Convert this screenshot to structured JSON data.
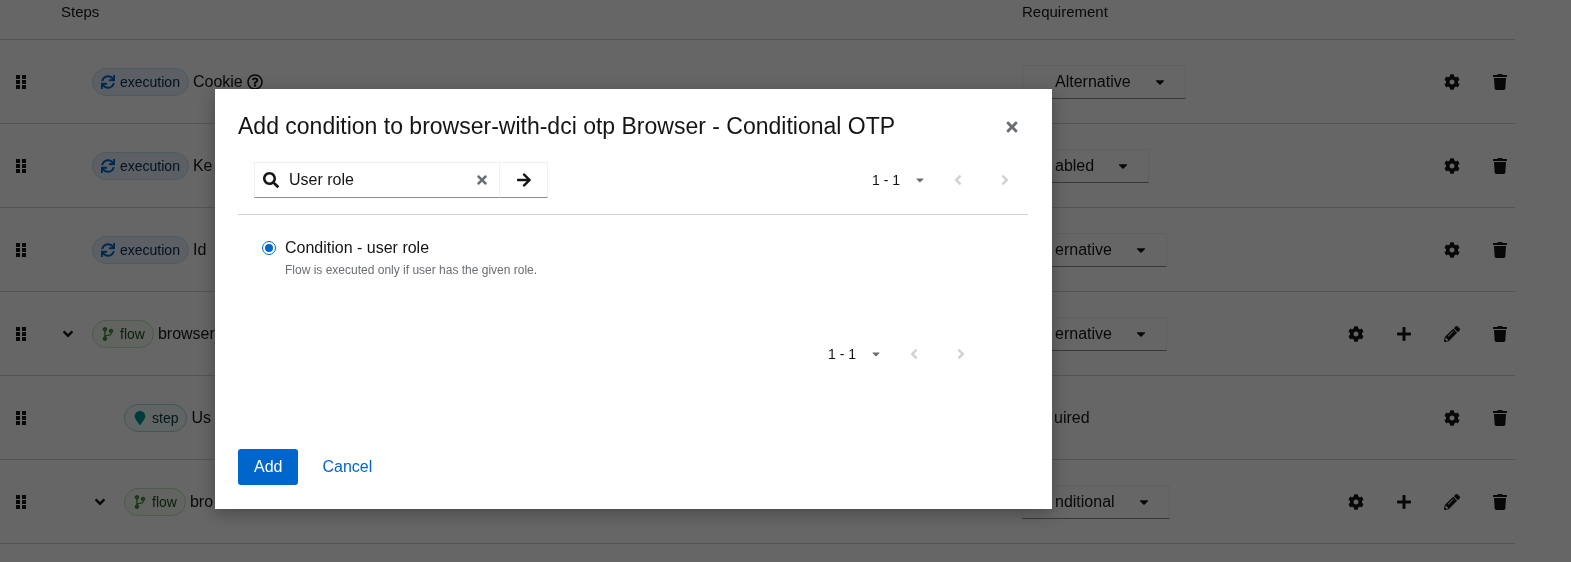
{
  "table": {
    "columns": [
      "Steps",
      "Requirement"
    ],
    "rows": [
      {
        "kind": "execution",
        "badge": "execution",
        "name": "Cookie",
        "help": true,
        "requirement": {
          "kind": "select",
          "value": "Alternative"
        }
      },
      {
        "kind": "execution",
        "badge": "execution",
        "name": "Ke",
        "help": false,
        "requirement": {
          "kind": "select",
          "value": "abled"
        }
      },
      {
        "kind": "execution",
        "badge": "execution",
        "name": "Id",
        "help": false,
        "requirement": {
          "kind": "select",
          "value": "ernative"
        }
      },
      {
        "kind": "flow",
        "badge": "flow",
        "name": "browser",
        "help": false,
        "expanded": true,
        "requirement": {
          "kind": "select",
          "value": "ernative"
        },
        "children": [
          {
            "kind": "step",
            "badge": "step",
            "name": "Us",
            "help": false,
            "requirement": {
              "kind": "text",
              "value": "uired"
            }
          },
          {
            "kind": "flow",
            "badge": "flow",
            "name": "bro",
            "help": false,
            "expanded": true,
            "requirement": {
              "kind": "select",
              "value": "nditional"
            }
          }
        ]
      }
    ]
  },
  "modal": {
    "title": "Add condition to browser-with-dci otp Browser - Conditional OTP",
    "search": {
      "value": "User role"
    },
    "pagination_top": {
      "range": "1 - 1",
      "prev_disabled": true,
      "next_disabled": true
    },
    "options": [
      {
        "label": "Condition - user role",
        "description": "Flow is executed only if user has the given role.",
        "selected": true
      }
    ],
    "pagination_bottom": {
      "range": "1 - 1",
      "prev_disabled": true,
      "next_disabled": true
    },
    "buttons": {
      "primary": "Add",
      "link": "Cancel"
    }
  }
}
